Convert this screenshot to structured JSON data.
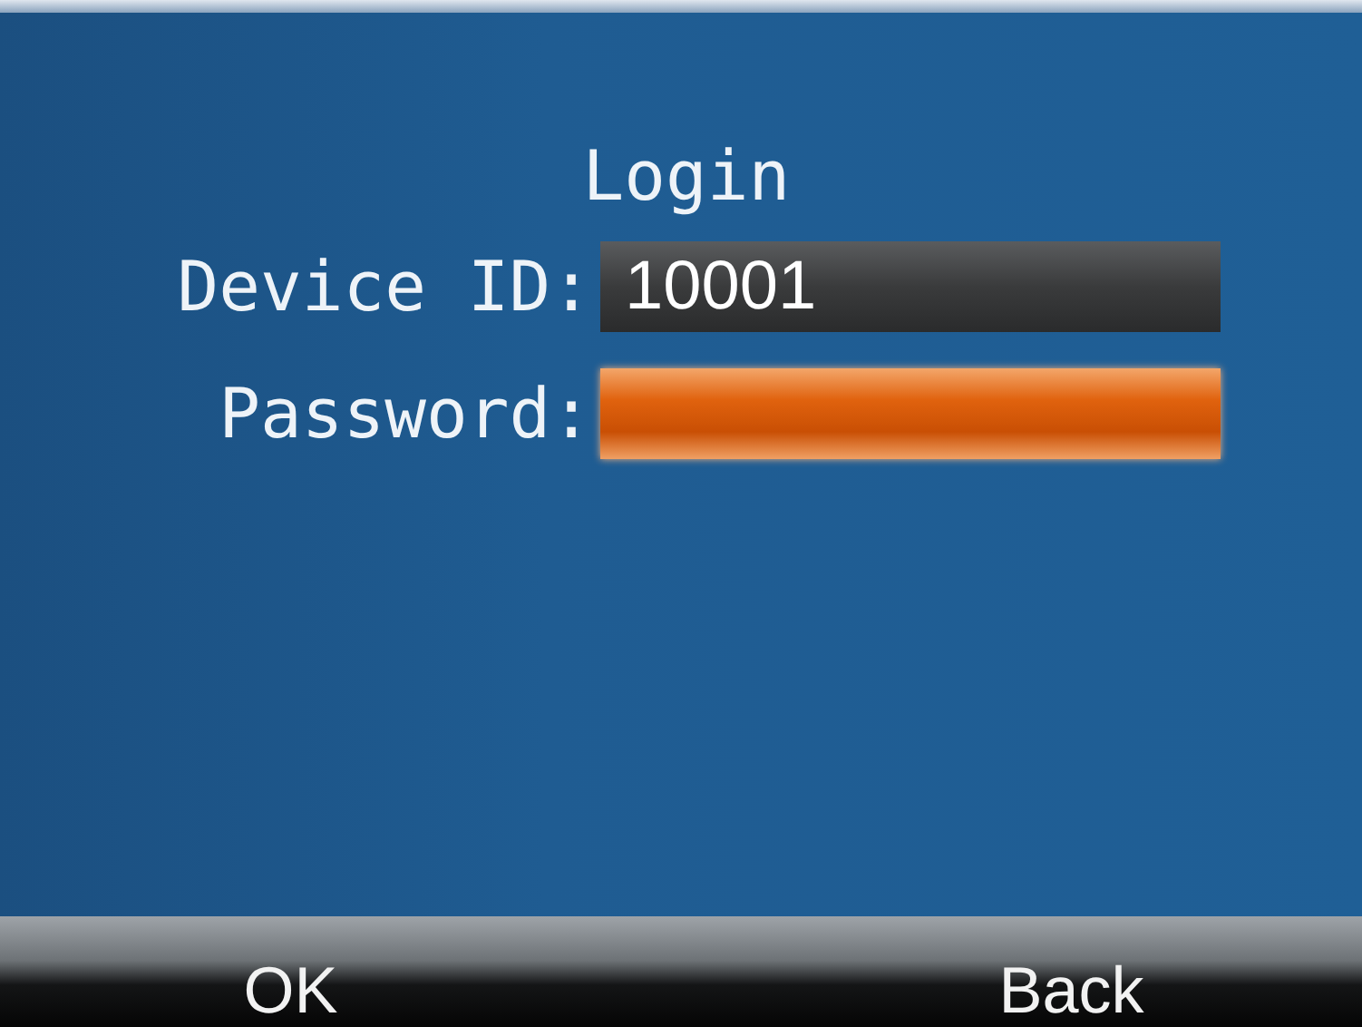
{
  "title": "Login",
  "fields": [
    {
      "label": "Device ID:",
      "value": "10001",
      "selected": false
    },
    {
      "label": "Password:",
      "selected": true
    }
  ],
  "buttons": [
    "OK",
    "Back"
  ]
}
